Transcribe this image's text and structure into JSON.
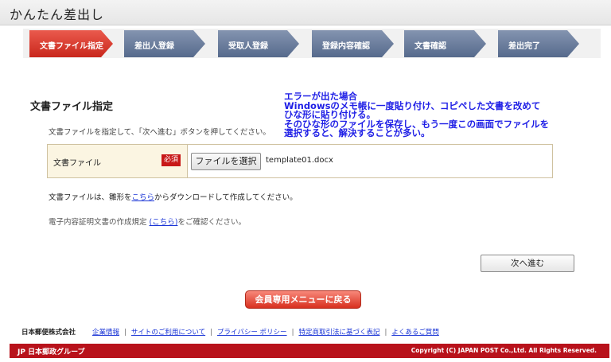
{
  "app": {
    "title": "かんたん差出し"
  },
  "steps": [
    {
      "label": "文書ファイル指定",
      "active": true
    },
    {
      "label": "差出人登録",
      "active": false
    },
    {
      "label": "受取人登録",
      "active": false
    },
    {
      "label": "登録内容確認",
      "active": false
    },
    {
      "label": "文書確認",
      "active": false
    },
    {
      "label": "差出完了",
      "active": false
    }
  ],
  "main": {
    "section_title": "文書ファイル指定",
    "instruction": "文書ファイルを指定して、「次へ進む」ボタンを押してください。",
    "form": {
      "label": "文書ファイル",
      "required_badge": "必須",
      "file_button": "ファイルを選択",
      "file_name": "template01.docx"
    },
    "download": {
      "before": "文書ファイルは、雛形を",
      "link": "こちら",
      "after": "からダウンロードして作成してください。"
    },
    "spec": {
      "before": "電子内容証明文書の作成規定 ",
      "link": "(こちら)",
      "after": "をご確認ください。"
    },
    "next_button": "次へ進む",
    "menu_button": "会員専用メニューに戻る"
  },
  "annotation": {
    "lines": [
      "エラーが出た場合",
      "Windowsのメモ帳に一度貼り付け、コピペした文書を改めて",
      "ひな形に貼り付ける。",
      "そのひな形のファイルを保存し、もう一度この画面でファイルを",
      "選択すると、解決することが多い。"
    ],
    "color": "#1f1fe6"
  },
  "footer": {
    "company": "日本郵便株式会社",
    "links": [
      "企業情報",
      "サイトのご利用について",
      "プライバシー ポリシー",
      "特定商取引法に基づく表記",
      "よくあるご質問"
    ],
    "separator": "|",
    "group": "JP 日本郵政グループ",
    "copyright": "Copyright (C) JAPAN POST Co.,Ltd.  All Rights Reserved.",
    "bar_color": "#b8121b"
  },
  "colors": {
    "active_step": "#d8372a",
    "inactive_step": "#6a7c9c",
    "link": "#1a35d6"
  }
}
